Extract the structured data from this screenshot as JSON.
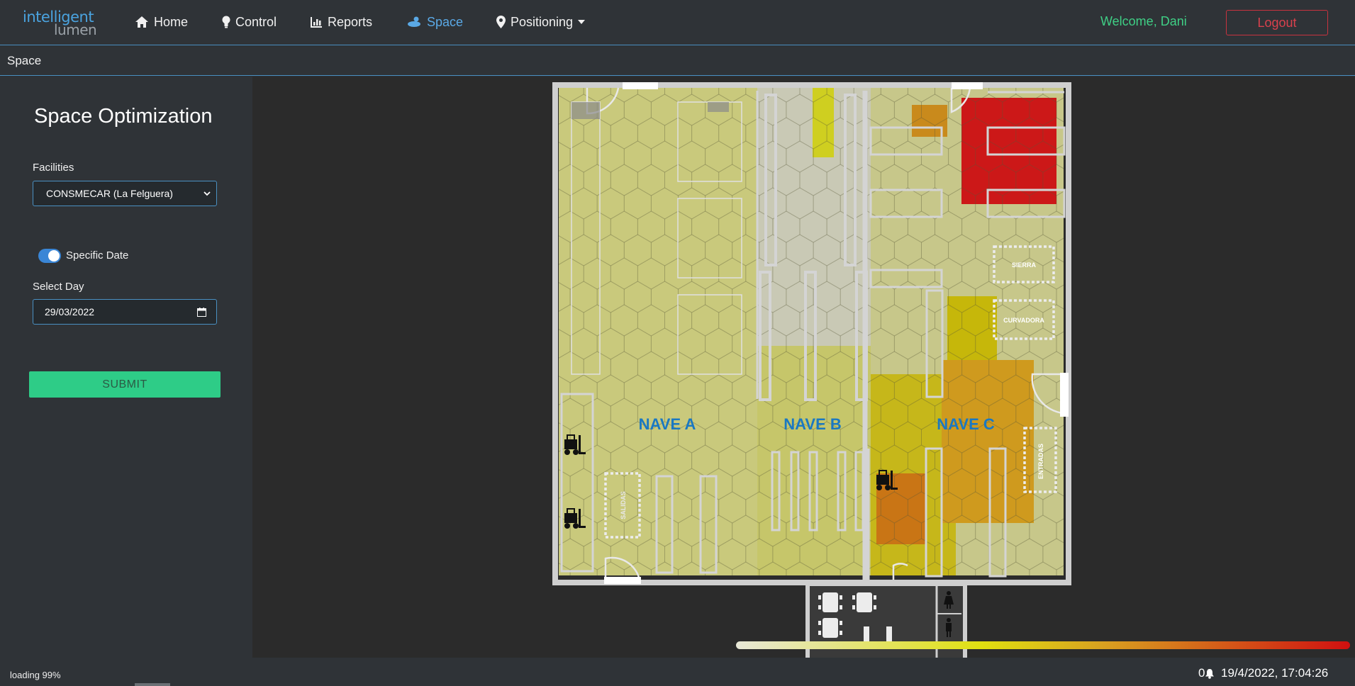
{
  "app": {
    "logo_line1": "intelligent",
    "logo_line2": "lumen"
  },
  "nav": {
    "items": [
      {
        "label": "Home",
        "icon": "home-icon"
      },
      {
        "label": "Control",
        "icon": "bulb-icon"
      },
      {
        "label": "Reports",
        "icon": "bar-chart-icon"
      },
      {
        "label": "Space",
        "icon": "space-icon",
        "active": true
      },
      {
        "label": "Positioning",
        "icon": "map-pin-icon",
        "dropdown": true
      }
    ],
    "welcome": "Welcome, Dani",
    "logout": "Logout"
  },
  "breadcrumb": "Space",
  "sidebar": {
    "title": "Space Optimization",
    "facilities_label": "Facilities",
    "facility_value": "CONSMECAR (La Felguera)",
    "toggle_label": "Specific Date",
    "toggle_on": true,
    "select_day_label": "Select Day",
    "date_value": "29/03/2022",
    "submit": "SUBMIT"
  },
  "floorplan": {
    "zones": [
      "NAVE A",
      "NAVE B",
      "NAVE C"
    ],
    "areas": [
      "SIERRA",
      "CURVADORA",
      "ENTRADAS",
      "SALIDAS"
    ],
    "accent_color": "#1a78c2",
    "heat_colors": [
      "#e8e8d8",
      "#e0e010",
      "#d8a020",
      "#d01010"
    ]
  },
  "status": {
    "loading": "loading 99%",
    "notifications": "0",
    "datetime": "19/4/2022, 17:04:26"
  }
}
